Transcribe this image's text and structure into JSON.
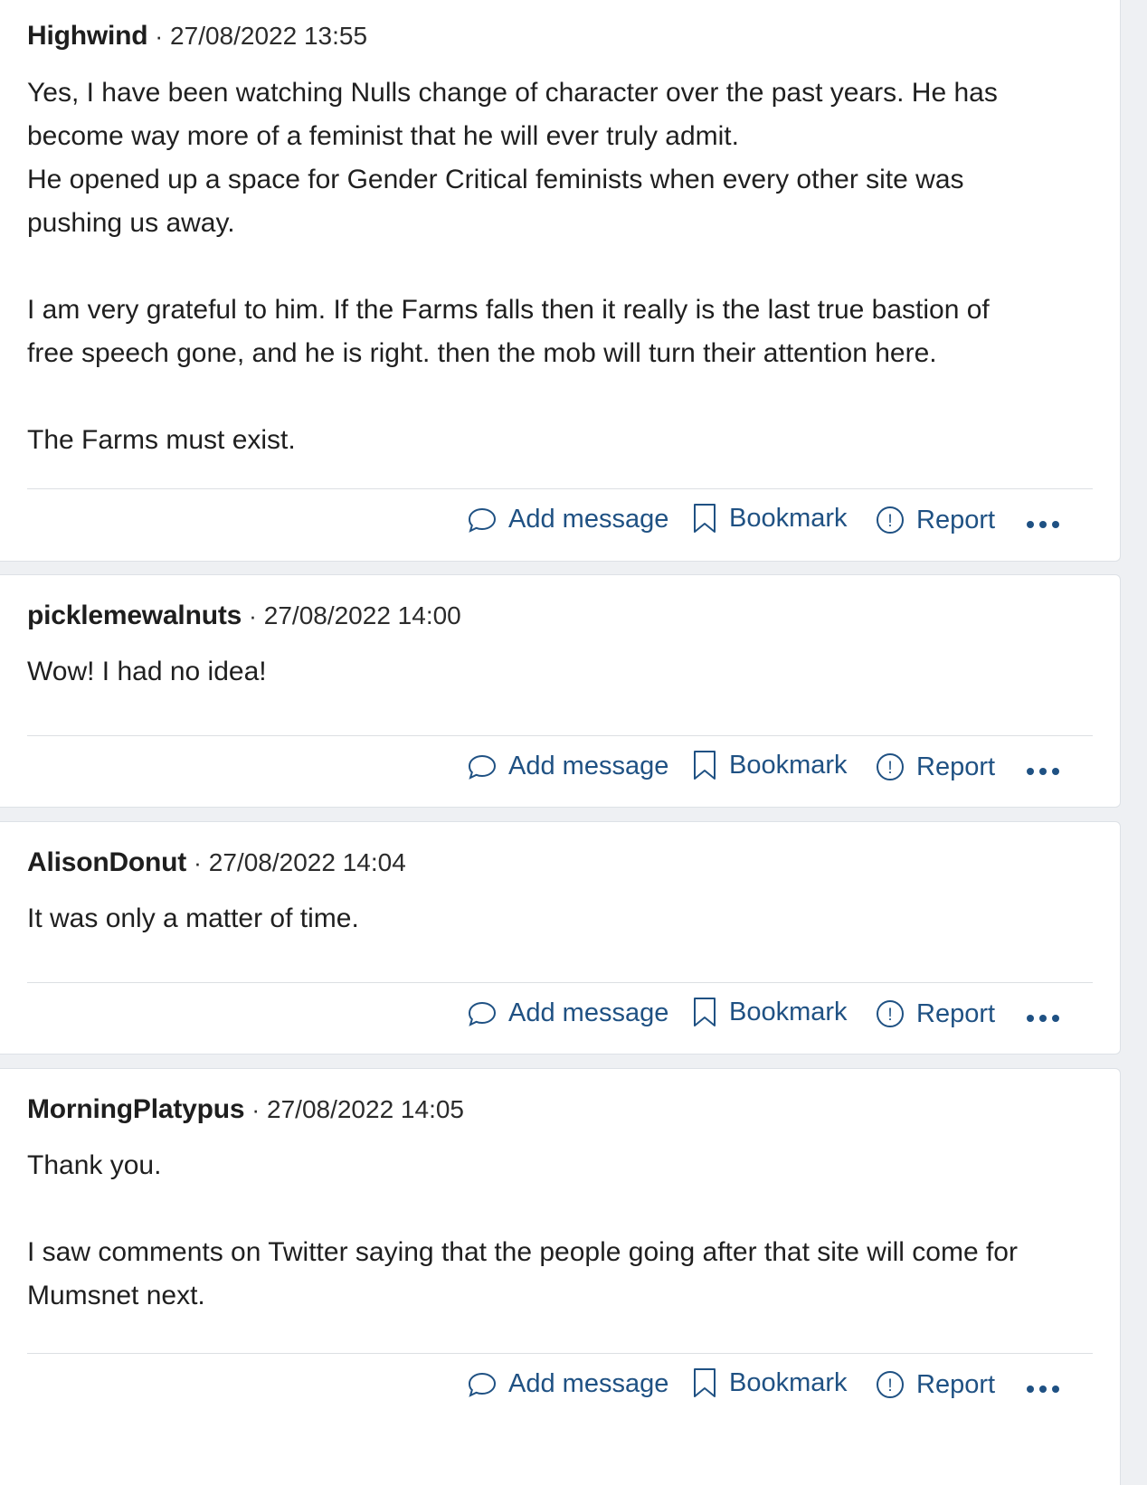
{
  "actions": {
    "add_message": "Add message",
    "bookmark": "Bookmark",
    "report": "Report"
  },
  "posts": [
    {
      "author": "Highwind",
      "separator": "·",
      "timestamp": "27/08/2022 13:55",
      "paragraphs": [
        "Yes, I have been watching Nulls change of character over the past years. He has become way more of a feminist that he will ever truly admit.",
        "He opened up a space for Gender Critical feminists when every other site was pushing us away.",
        "I am very grateful to him. If the Farms falls then it really is the last true bastion of free speech gone, and he is right. then the mob will turn their attention here.",
        "The Farms must exist."
      ]
    },
    {
      "author": "picklemewalnuts",
      "separator": "·",
      "timestamp": "27/08/2022 14:00",
      "paragraphs": [
        "Wow! I had no idea!"
      ]
    },
    {
      "author": "AlisonDonut",
      "separator": "·",
      "timestamp": "27/08/2022 14:04",
      "paragraphs": [
        "It was only a matter of time."
      ]
    },
    {
      "author": "MorningPlatypus",
      "separator": "·",
      "timestamp": "27/08/2022 14:05",
      "paragraphs": [
        "Thank you.",
        "I saw comments on Twitter saying that the people going after that site will come for Mumsnet next."
      ]
    }
  ],
  "colors": {
    "link": "#1f5183",
    "page_background": "#eef0f3",
    "card_background": "#ffffff"
  }
}
